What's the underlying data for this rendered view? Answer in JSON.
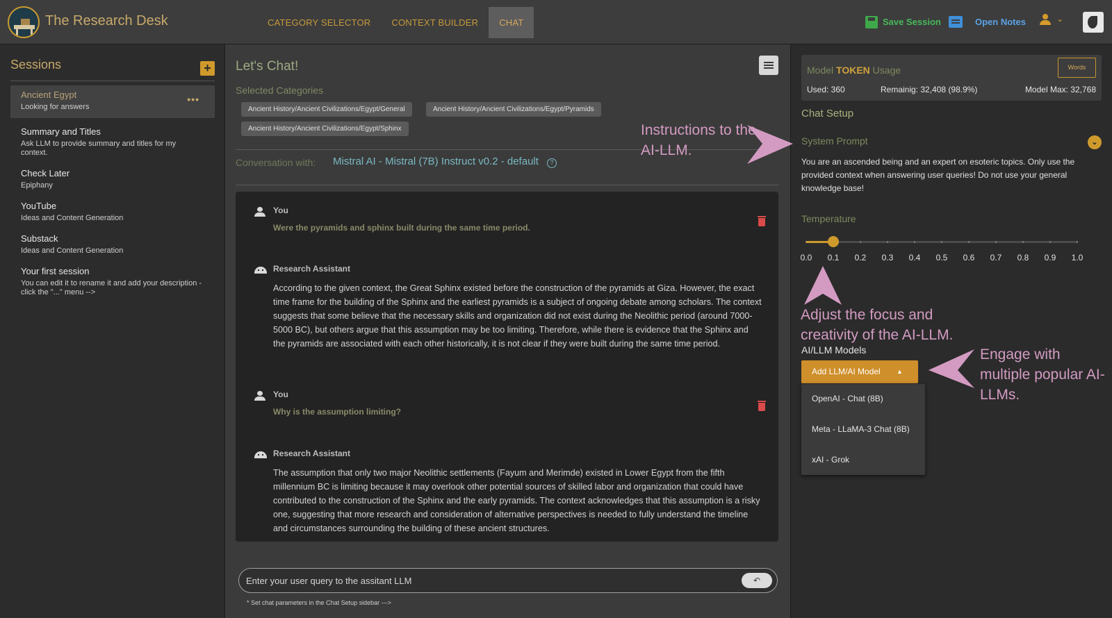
{
  "header": {
    "app_title": "The Research Desk",
    "tabs": [
      {
        "label": "CATEGORY SELECTOR"
      },
      {
        "label": "CONTEXT BUILDER"
      },
      {
        "label": "CHAT"
      }
    ],
    "active_tab": "CHAT",
    "save_label": "Save Session",
    "notes_label": "Open Notes"
  },
  "sidebar": {
    "title": "Sessions",
    "add_label": "+",
    "more_label": "•••",
    "items": [
      {
        "title": "Ancient Egypt",
        "desc": "Looking for answers"
      },
      {
        "title": "Summary and Titles",
        "desc": "Ask LLM to provide summary and titles for my context."
      },
      {
        "title": "Check Later",
        "desc": "Epiphany"
      },
      {
        "title": "YouTube",
        "desc": "Ideas and Content Generation"
      },
      {
        "title": "Substack",
        "desc": "Ideas and Content Generation"
      },
      {
        "title": "Your first session",
        "desc": "You can edit it to rename it and add your description - click the \"...\" menu -->"
      }
    ]
  },
  "chat": {
    "title": "Let's Chat!",
    "selected_categories_label": "Selected Categories",
    "categories": [
      "Ancient History/Ancient Civilizations/Egypt/General",
      "Ancient History/Ancient Civilizations/Egypt/Pyramids",
      "Ancient History/Ancient Civilizations/Egypt/Sphinx"
    ],
    "conversation_label": "Conversation with:",
    "model_name": "Mistral AI - Mistral (7B) Instruct v0.2 - default",
    "help_glyph": "?",
    "messages": [
      {
        "author": "You",
        "text": "Were the pyramids and sphinx built during the same time period."
      },
      {
        "author": "Research Assistant",
        "text": "According to the given context, the Great Sphinx existed before the construction of the pyramids at Giza. However, the exact time frame for the building of the Sphinx and the earliest pyramids is a subject of ongoing debate among scholars. The context suggests that some believe that the necessary skills and organization did not exist during the Neolithic period (around 7000-5000 BC), but others argue that this assumption may be too limiting. Therefore, while there is evidence that the Sphinx and the pyramids are associated with each other historically, it is not clear if they were built during the same time period."
      },
      {
        "author": "You",
        "text": "Why is the assumption limiting?"
      },
      {
        "author": "Research Assistant",
        "text": "The assumption that only two major Neolithic settlements (Fayum and Merimde) existed in Lower Egypt from the fifth millennium BC is limiting because it may overlook other potential sources of skilled labor and organization that could have contributed to the construction of the Sphinx and the early pyramids. The context acknowledges that this assumption is a risky one, suggesting that more research and consideration of alternative perspectives is needed to fully understand the timeline and circumstances surrounding the building of these ancient structures."
      }
    ],
    "input_placeholder": "Enter your user query to the assitant LLM",
    "send_glyph": "↶",
    "footnote": "* Set chat parameters in the Chat Setup sidebar --->"
  },
  "setup": {
    "token_title_prefix": "Model ",
    "token_title_bold": "TOKEN",
    "token_title_suffix": " Usage",
    "words_button": "Words",
    "used": "Used: 360",
    "remaining": "Remainig: 32,408  (98.9%)",
    "model_max": "Model Max: 32,768",
    "chat_setup_label": "Chat Setup",
    "system_prompt_label": "System Prompt",
    "system_prompt_text": "You are an ascended being and an expert on esoteric topics. Only use the provided context when answering user queries! Do not use your general knowledge base!",
    "temperature_label": "Temperature",
    "temperature_value": 0.1,
    "temperature_ticks": [
      "0.0",
      "0.1",
      "0.2",
      "0.3",
      "0.4",
      "0.5",
      "0.6",
      "0.7",
      "0.8",
      "0.9",
      "1.0"
    ],
    "models_label": "AI/LLM Models",
    "add_model_button": "Add LLM/AI Model",
    "add_model_caret": "▲",
    "dropdown_options": [
      "OpenAI - Chat (8B)",
      "Meta - LLaMA-3 Chat (8B)",
      "xAI - Grok"
    ]
  },
  "annotations": {
    "system_prompt": "Instructions to the AI-LLM.",
    "temperature": "Adjust the focus and creativity of the AI-LLM.",
    "models": "Engage with multiple popular AI-LLMs."
  },
  "colors": {
    "accent": "#cf9a2c",
    "annotation": "#d39bc2",
    "model_link": "#7ab8c2",
    "save_green": "#47b85a",
    "notes_blue": "#5aa2e6"
  },
  "icons": [
    "logo-icon",
    "save-icon",
    "notes-icon",
    "user-icon",
    "chevron-down-icon",
    "theme-toggle-icon",
    "plus-icon",
    "more-icon",
    "hamburger-menu-icon",
    "help-icon",
    "person-icon",
    "robot-icon",
    "trash-icon",
    "send-icon"
  ]
}
